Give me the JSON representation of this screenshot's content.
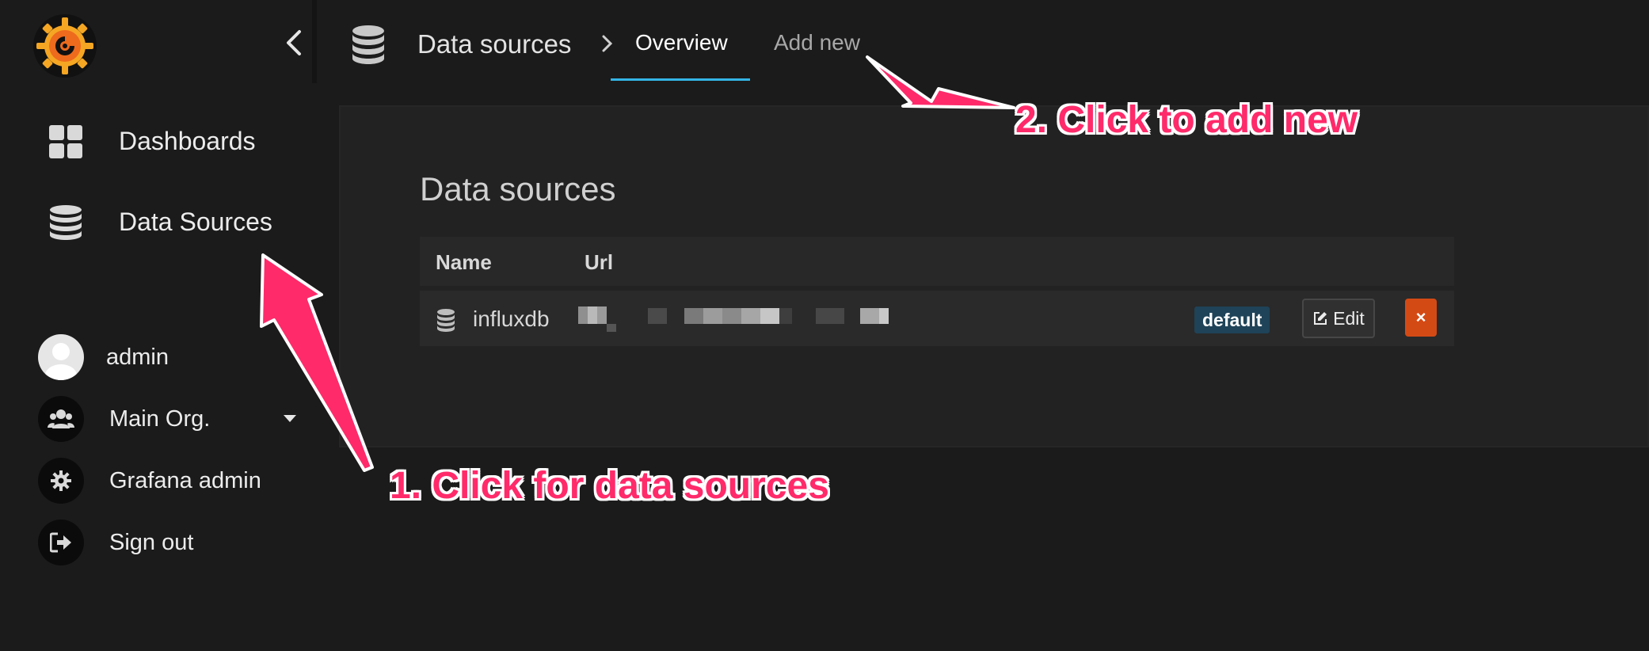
{
  "sidebar": {
    "nav": [
      {
        "label": "Dashboards",
        "icon": "dashboards-grid-icon"
      },
      {
        "label": "Data Sources",
        "icon": "database-icon"
      }
    ],
    "user": [
      {
        "label": "admin",
        "icon": "avatar"
      },
      {
        "label": "Main Org.",
        "icon": "users-group-icon"
      },
      {
        "label": "Grafana admin",
        "icon": "gear-icon"
      },
      {
        "label": "Sign out",
        "icon": "sign-out-icon"
      }
    ]
  },
  "topbar": {
    "breadcrumb": "Data sources",
    "tabs": [
      {
        "label": "Overview",
        "active": true
      },
      {
        "label": "Add new",
        "active": false
      }
    ]
  },
  "main": {
    "title": "Data sources",
    "columns": [
      "Name",
      "Url"
    ],
    "rows": [
      {
        "name": "influxdb",
        "url": "",
        "badge": "default",
        "edit_label": "Edit",
        "delete_label": "×"
      }
    ]
  },
  "annotations": {
    "step1": "1. Click for data sources",
    "step2": "2. Click to add new"
  },
  "colors": {
    "background": "#1b1b1b",
    "panel": "#222222",
    "active_tab_underline": "#33b5e5",
    "badge": "#1f4358",
    "delete_button": "#d44a15",
    "annotation": "#ff2a6a"
  }
}
